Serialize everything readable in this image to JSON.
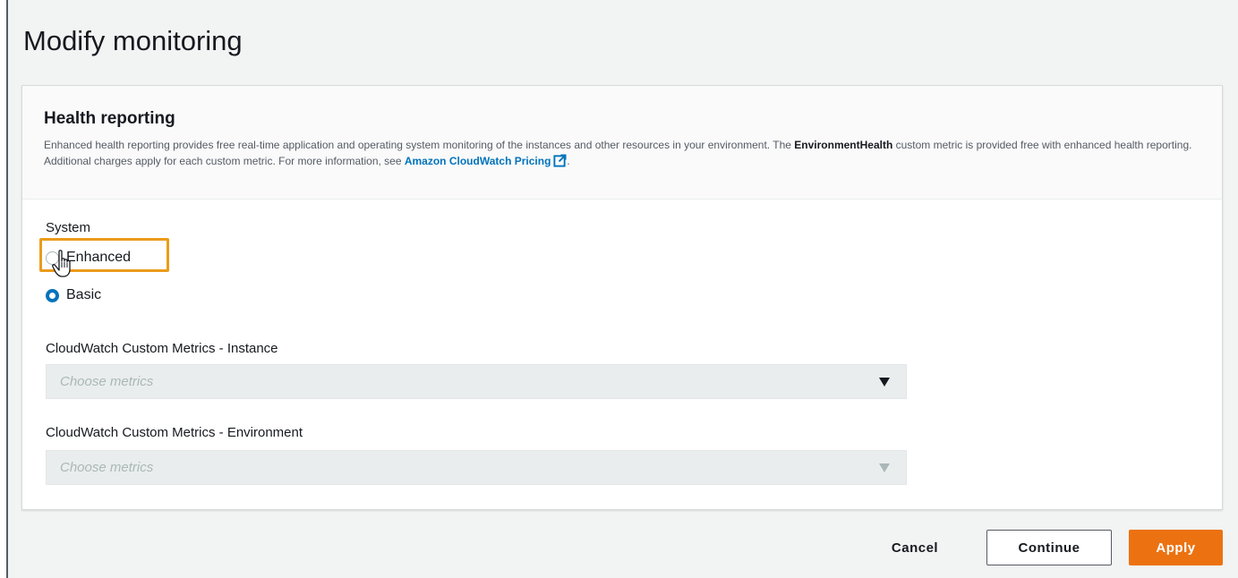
{
  "page": {
    "title": "Modify monitoring"
  },
  "health_reporting": {
    "title": "Health reporting",
    "description_part1": "Enhanced health reporting provides free real-time application and operating system monitoring of the instances and other resources in your environment. The ",
    "description_bold": "EnvironmentHealth",
    "description_part2": " custom metric is provided free with enhanced health reporting. Additional charges apply for each custom metric. For more information, see ",
    "link_text": "Amazon CloudWatch Pricing",
    "description_end": "."
  },
  "system": {
    "label": "System",
    "options": [
      {
        "label": "Enhanced",
        "checked": false
      },
      {
        "label": "Basic",
        "checked": true
      }
    ]
  },
  "instance_metrics": {
    "label": "CloudWatch Custom Metrics - Instance",
    "placeholder": "Choose metrics"
  },
  "environment_metrics": {
    "label": "CloudWatch Custom Metrics - Environment",
    "placeholder": "Choose metrics"
  },
  "actions": {
    "cancel": "Cancel",
    "continue": "Continue",
    "apply": "Apply"
  },
  "colors": {
    "accent": "#ec7211",
    "link": "#0073bb",
    "highlight": "#eb9b1a"
  },
  "icons": [
    "external-link-icon",
    "pointer-hand-icon",
    "caret-down-icon"
  ]
}
